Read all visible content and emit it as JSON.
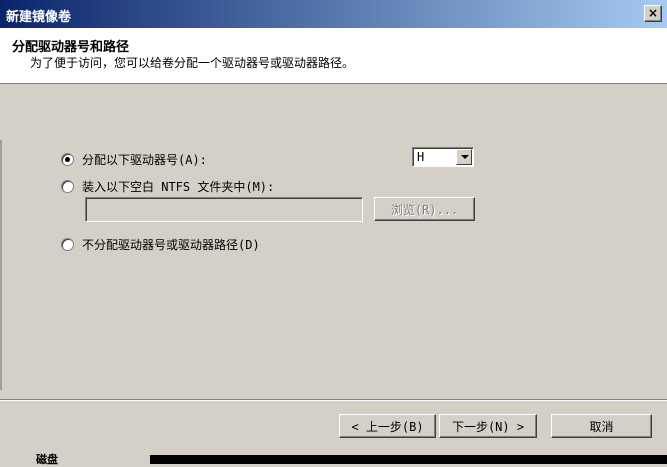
{
  "window": {
    "title": "新建镜像卷",
    "close_label": "×"
  },
  "header": {
    "title": "分配驱动器号和路径",
    "subtitle": "为了便于访问，您可以给卷分配一个驱动器号或驱动器路径。"
  },
  "options": {
    "assign_letter": {
      "label": "分配以下驱动器号(A):",
      "checked": true
    },
    "mount_folder": {
      "label": "装入以下空白 NTFS 文件夹中(M):",
      "checked": false
    },
    "no_assign": {
      "label": "不分配驱动器号或驱动器路径(D)",
      "checked": false
    }
  },
  "drive_letter": {
    "value": "H"
  },
  "folder_path": {
    "value": ""
  },
  "buttons": {
    "browse": "浏览(R)...",
    "back": "< 上一步(B)",
    "next": "下一步(N) >",
    "cancel": "取消"
  },
  "background": {
    "fragment": "磁盘"
  }
}
